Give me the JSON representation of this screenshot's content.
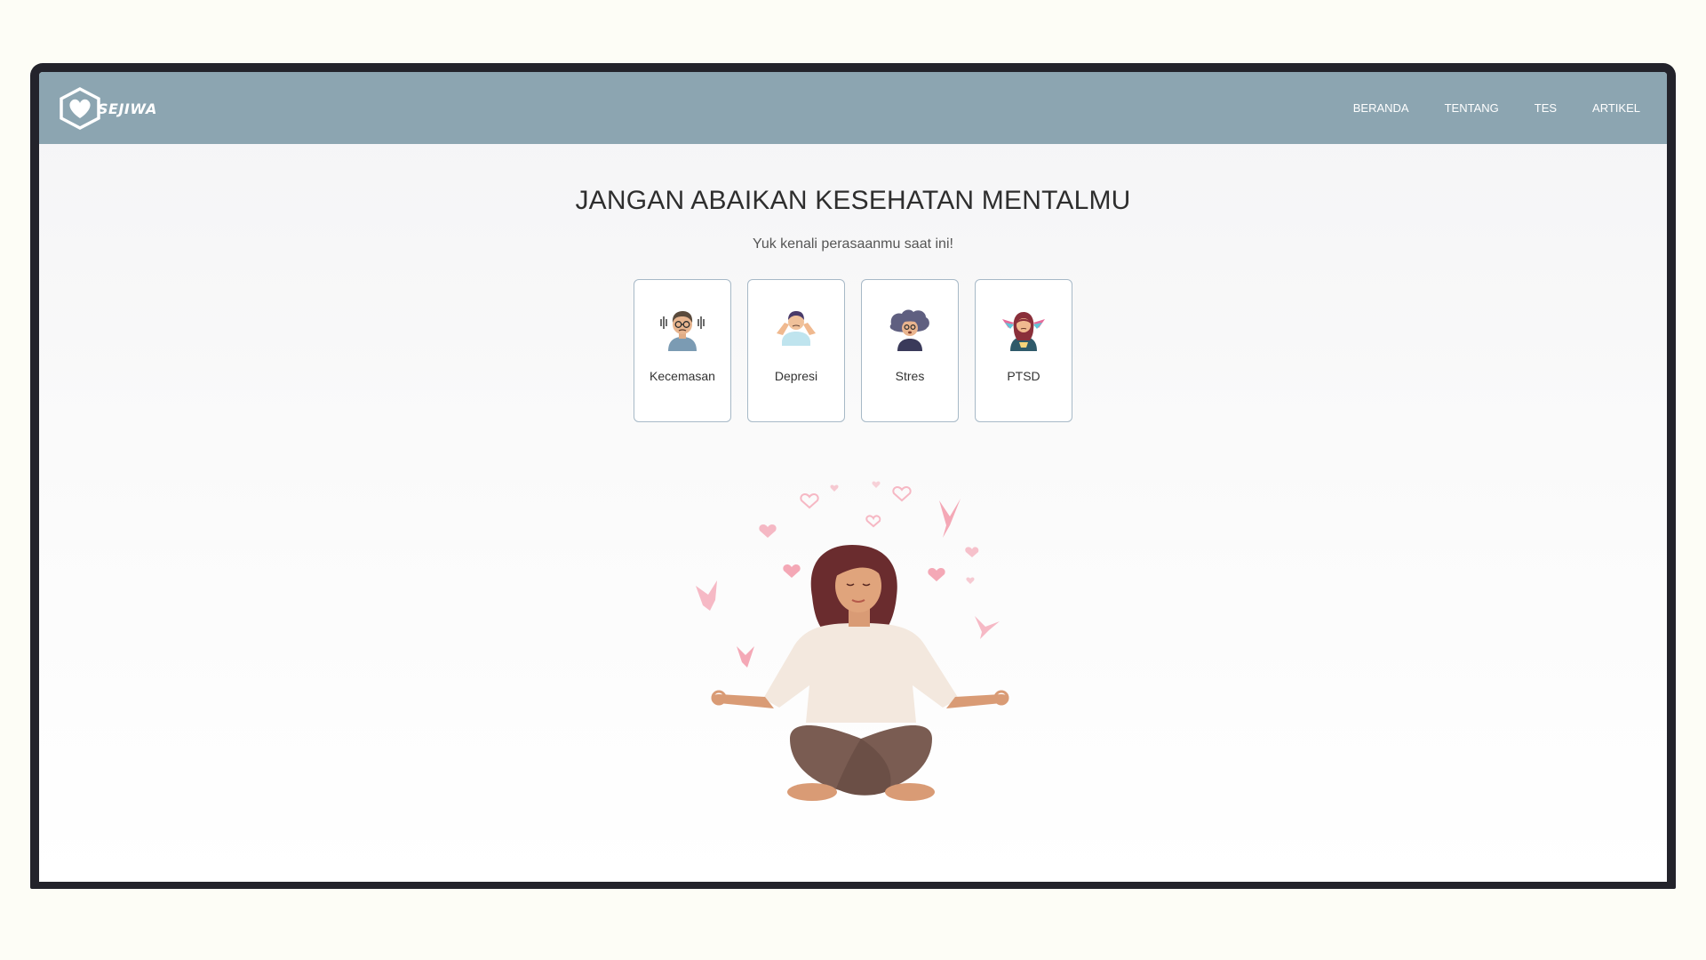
{
  "brand": {
    "name": "SEJIWA",
    "nav_color": "#8ca5b1"
  },
  "nav": {
    "items": [
      {
        "label": "BERANDA"
      },
      {
        "label": "TENTANG"
      },
      {
        "label": "TES"
      },
      {
        "label": "ARTIKEL"
      }
    ]
  },
  "hero": {
    "title": "JANGAN ABAIKAN KESEHATAN MENTALMU",
    "subtitle": "Yuk kenali perasaanmu saat ini!"
  },
  "tests": [
    {
      "label": "Kecemasan",
      "icon": "anxious-person-icon"
    },
    {
      "label": "Depresi",
      "icon": "depressed-person-icon"
    },
    {
      "label": "Stres",
      "icon": "stressed-person-icon"
    },
    {
      "label": "PTSD",
      "icon": "ptsd-person-icon"
    }
  ],
  "illustration": {
    "icon": "meditating-woman-illustration"
  }
}
